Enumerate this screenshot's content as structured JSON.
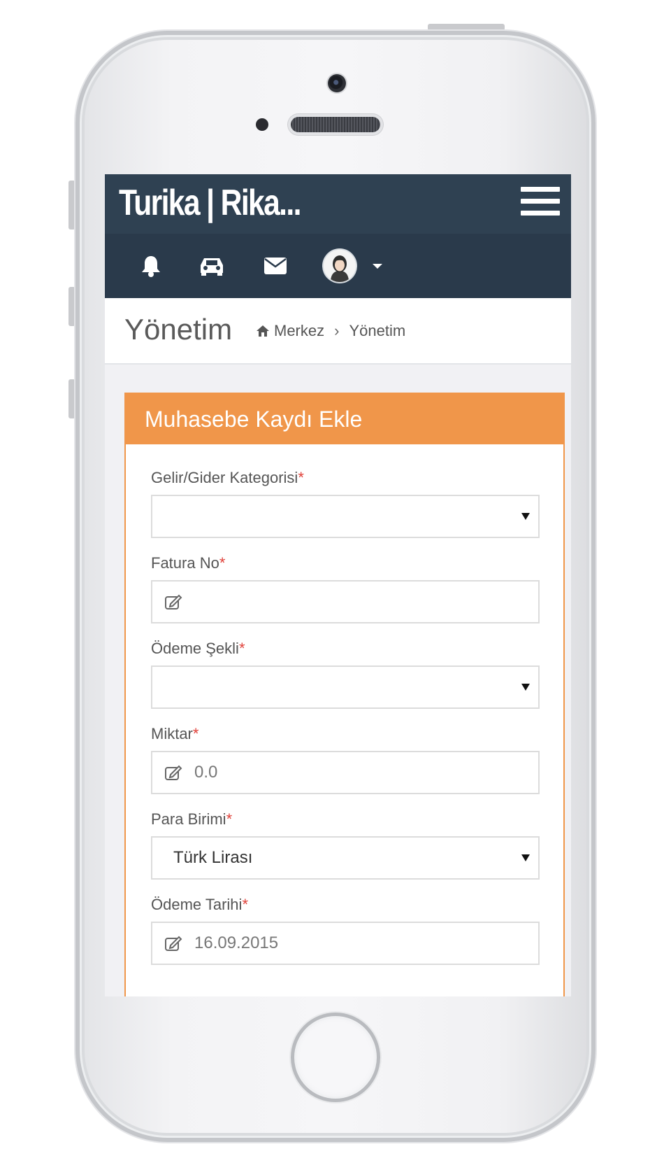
{
  "header": {
    "brand": "Turika | Rika...",
    "menu_icon": "hamburger-icon"
  },
  "toolbar": {
    "icons": [
      "bell-icon",
      "car-icon",
      "envelope-icon",
      "user-avatar",
      "caret-down-icon"
    ]
  },
  "page": {
    "title": "Yönetim",
    "breadcrumb": {
      "home_icon": "home-icon",
      "home_label": "Merkez",
      "separator": "›",
      "current": "Yönetim"
    }
  },
  "form": {
    "title": "Muhasebe Kaydı Ekle",
    "required_mark": "*",
    "fields": [
      {
        "label": "Gelir/Gider Kategorisi",
        "type": "select",
        "value": ""
      },
      {
        "label": "Fatura No",
        "type": "text",
        "value": "",
        "placeholder": ""
      },
      {
        "label": "Ödeme Şekli",
        "type": "select",
        "value": ""
      },
      {
        "label": "Miktar",
        "type": "text",
        "value": "",
        "placeholder": "0.0"
      },
      {
        "label": "Para Birimi",
        "type": "select",
        "value": "Türk Lirası"
      },
      {
        "label": "Ödeme Tarihi",
        "type": "text",
        "value": "",
        "placeholder": "16.09.2015"
      }
    ]
  },
  "colors": {
    "navbar": "#2f4152",
    "iconbar": "#2a3a4b",
    "accent": "#f0964a",
    "required": "#e0413a"
  }
}
